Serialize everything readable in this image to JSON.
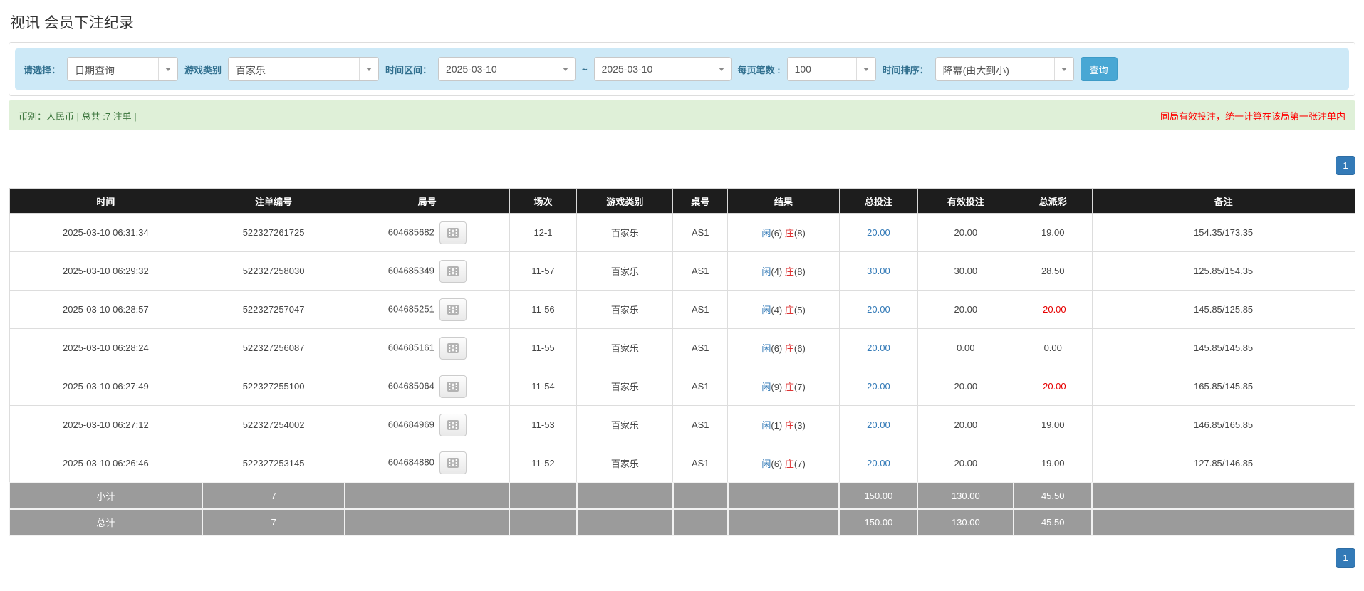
{
  "page": {
    "title": "视讯 会员下注纪录"
  },
  "filters": {
    "select_label": "请选择：",
    "select_value": "日期查询",
    "game_type_label": "游戏类别",
    "game_type_value": "百家乐",
    "date_range_label": "时间区间：",
    "date_from": "2025-03-10",
    "range_separator": "~",
    "date_to": "2025-03-10",
    "page_size_label": "每页笔数 :",
    "page_size_value": "100",
    "sort_label": "时间排序：",
    "sort_value": "降冪(由大到小)",
    "search_button": "查询"
  },
  "summary": {
    "left_text": "币别：人民币 | 总共 :7 注单 |",
    "right_notice": "同局有效投注，统一计算在该局第一张注单内"
  },
  "pagination": {
    "page": "1"
  },
  "table": {
    "columns": [
      "时间",
      "注单编号",
      "局号",
      "场次",
      "游戏类别",
      "桌号",
      "结果",
      "总投注",
      "有效投注",
      "总派彩",
      "备注"
    ],
    "rows": [
      {
        "time": "2025-03-10 06:31:34",
        "bet_id": "522327261725",
        "round_id": "604685682",
        "session": "12-1",
        "game": "百家乐",
        "table_no": "AS1",
        "player_label": "闲",
        "player_score": "(6)",
        "banker_label": "庄",
        "banker_score": "(8)",
        "total_bet": "20.00",
        "valid_bet": "20.00",
        "payout": "19.00",
        "payout_negative": false,
        "remark": "154.35/173.35"
      },
      {
        "time": "2025-03-10 06:29:32",
        "bet_id": "522327258030",
        "round_id": "604685349",
        "session": "11-57",
        "game": "百家乐",
        "table_no": "AS1",
        "player_label": "闲",
        "player_score": "(4)",
        "banker_label": "庄",
        "banker_score": "(8)",
        "total_bet": "30.00",
        "valid_bet": "30.00",
        "payout": "28.50",
        "payout_negative": false,
        "remark": "125.85/154.35"
      },
      {
        "time": "2025-03-10 06:28:57",
        "bet_id": "522327257047",
        "round_id": "604685251",
        "session": "11-56",
        "game": "百家乐",
        "table_no": "AS1",
        "player_label": "闲",
        "player_score": "(4)",
        "banker_label": "庄",
        "banker_score": "(5)",
        "total_bet": "20.00",
        "valid_bet": "20.00",
        "payout": "-20.00",
        "payout_negative": true,
        "remark": "145.85/125.85"
      },
      {
        "time": "2025-03-10 06:28:24",
        "bet_id": "522327256087",
        "round_id": "604685161",
        "session": "11-55",
        "game": "百家乐",
        "table_no": "AS1",
        "player_label": "闲",
        "player_score": "(6)",
        "banker_label": "庄",
        "banker_score": "(6)",
        "total_bet": "20.00",
        "valid_bet": "0.00",
        "payout": "0.00",
        "payout_negative": false,
        "remark": "145.85/145.85"
      },
      {
        "time": "2025-03-10 06:27:49",
        "bet_id": "522327255100",
        "round_id": "604685064",
        "session": "11-54",
        "game": "百家乐",
        "table_no": "AS1",
        "player_label": "闲",
        "player_score": "(9)",
        "banker_label": "庄",
        "banker_score": "(7)",
        "total_bet": "20.00",
        "valid_bet": "20.00",
        "payout": "-20.00",
        "payout_negative": true,
        "remark": "165.85/145.85"
      },
      {
        "time": "2025-03-10 06:27:12",
        "bet_id": "522327254002",
        "round_id": "604684969",
        "session": "11-53",
        "game": "百家乐",
        "table_no": "AS1",
        "player_label": "闲",
        "player_score": "(1)",
        "banker_label": "庄",
        "banker_score": "(3)",
        "total_bet": "20.00",
        "valid_bet": "20.00",
        "payout": "19.00",
        "payout_negative": false,
        "remark": "146.85/165.85"
      },
      {
        "time": "2025-03-10 06:26:46",
        "bet_id": "522327253145",
        "round_id": "604684880",
        "session": "11-52",
        "game": "百家乐",
        "table_no": "AS1",
        "player_label": "闲",
        "player_score": "(6)",
        "banker_label": "庄",
        "banker_score": "(7)",
        "total_bet": "20.00",
        "valid_bet": "20.00",
        "payout": "19.00",
        "payout_negative": false,
        "remark": "127.85/146.85"
      }
    ],
    "subtotal": {
      "label": "小计",
      "count": "7",
      "total_bet": "150.00",
      "valid_bet": "130.00",
      "payout": "45.50"
    },
    "total": {
      "label": "总计",
      "count": "7",
      "total_bet": "150.00",
      "valid_bet": "130.00",
      "payout": "45.50"
    }
  },
  "colors": {
    "filter_bar_bg": "#cde9f7",
    "filter_label_blue": "#31708f",
    "search_button_blue": "#48a7d4",
    "success_bar_bg": "#dff0d8",
    "success_text": "#3c763d",
    "notice_red": "#ff0000",
    "table_header_bg": "#1d1d1d",
    "summary_row_bg": "#9b9b9b",
    "link_blue": "#337ab7",
    "player_blue": "#337ab7",
    "banker_red": "#dd3333",
    "negative_red": "#e60000",
    "pagination_blue": "#337ab7"
  }
}
